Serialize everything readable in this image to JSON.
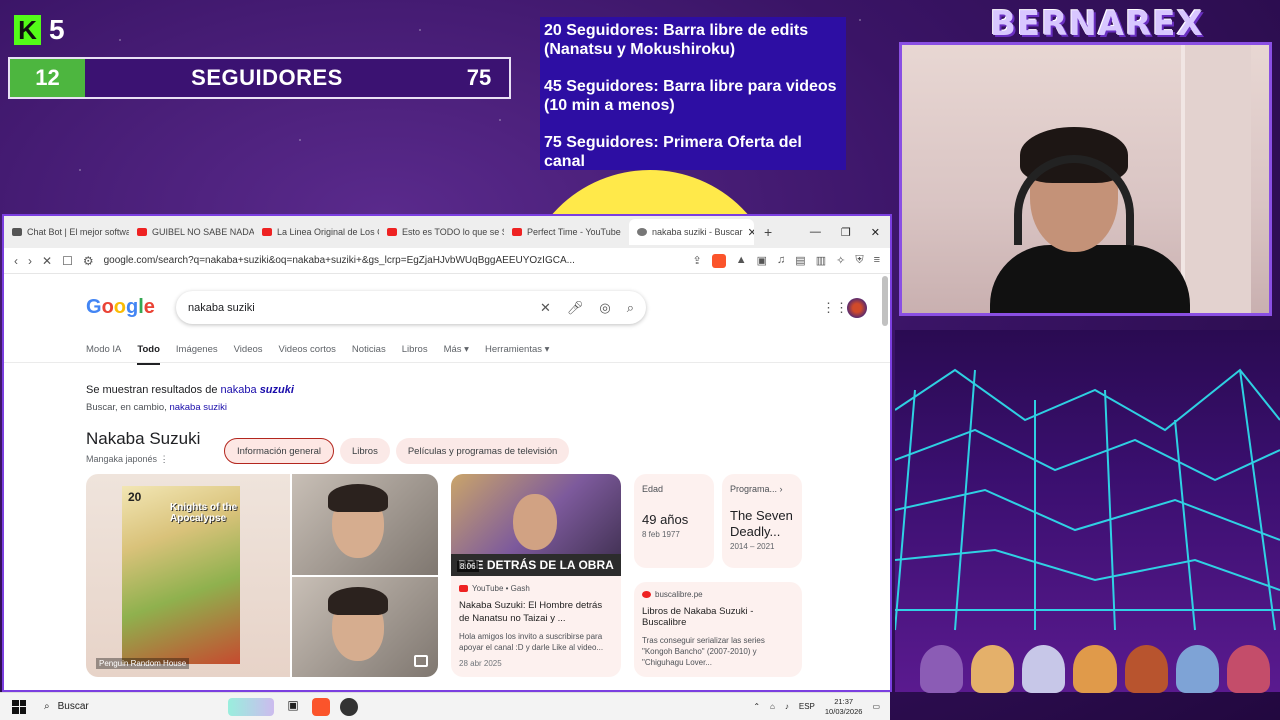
{
  "overlay": {
    "kick_count": "5",
    "goal": {
      "current": "12",
      "label": "SEGUIDORES",
      "max": "75",
      "progress_fraction": 0.16
    },
    "goals_list": [
      "20 Seguidores: Barra libre de edits (Nanatsu y Mokushiroku)",
      "45 Seguidores: Barra libre para videos (10 min a menos)",
      "75 Seguidores: Primera Oferta del canal"
    ],
    "brand": "BERNAREX"
  },
  "browser": {
    "tabs": [
      {
        "label": "Chat Bot | El mejor software",
        "icon": "chat-icon"
      },
      {
        "label": "GUIBEL NO SABE NADA DE",
        "icon": "youtube-icon"
      },
      {
        "label": "La Linea Original de Los C",
        "icon": "youtube-icon"
      },
      {
        "label": "Esto es TODO lo que se SA",
        "icon": "youtube-icon"
      },
      {
        "label": "Perfect Time - YouTube",
        "icon": "youtube-icon"
      },
      {
        "label": "nakaba suziki - Buscar",
        "icon": "google-icon",
        "active": true
      }
    ],
    "url": "google.com/search?q=nakaba+suziki&oq=nakaba+suziki+&gs_lcrp=EgZjaHJvbWUqBggAEEUYOzIGCA..."
  },
  "google": {
    "query": "nakaba suziki",
    "tabs": [
      "Modo IA",
      "Todo",
      "Imágenes",
      "Videos",
      "Videos cortos",
      "Noticias",
      "Libros",
      "Más",
      "Herramientas"
    ],
    "active_tab": "Todo",
    "showing_prefix": "Se muestran resultados de ",
    "showing_name": "nakaba ",
    "showing_em": "suzuki",
    "instead_prefix": "Buscar, en cambio, ",
    "instead_link": "nakaba suziki",
    "kp_title": "Nakaba Suzuki",
    "kp_subtitle": "Mangaka japonés",
    "chips": [
      "Información general",
      "Libros",
      "Películas y programas de televisión"
    ],
    "book": {
      "number": "20",
      "title": "Knights of the Apocalypse",
      "publisher": "Penguin Random House"
    },
    "video": {
      "duration": "8:06",
      "banner": "BRE DETRÁS DE LA OBRA",
      "source": "YouTube • Gash",
      "title": "Nakaba Suzuki: El Hombre detrás de Nanatsu no Taizai y ...",
      "desc": "Hola amigos los invito a suscribirse para apoyar el canal :D y darle Like al video...",
      "date": "28 abr 2025"
    },
    "facts": [
      {
        "label": "Edad",
        "value": "49 años",
        "sub": "8 feb 1977"
      },
      {
        "label": "Programa...",
        "value": "The Seven Deadly...",
        "sub": "2014 – 2021"
      }
    ],
    "source_card": {
      "site": "buscalibre.pe",
      "title": "Libros de Nakaba Suzuki - Buscalibre",
      "desc": "Tras conseguir serializar las series \"Kongoh Bancho\" (2007-2010) y \"Chiguhagu Lover..."
    }
  },
  "taskbar": {
    "search": "Buscar",
    "lang": "ESP",
    "time": "21:37",
    "date": "10/03/2026"
  }
}
